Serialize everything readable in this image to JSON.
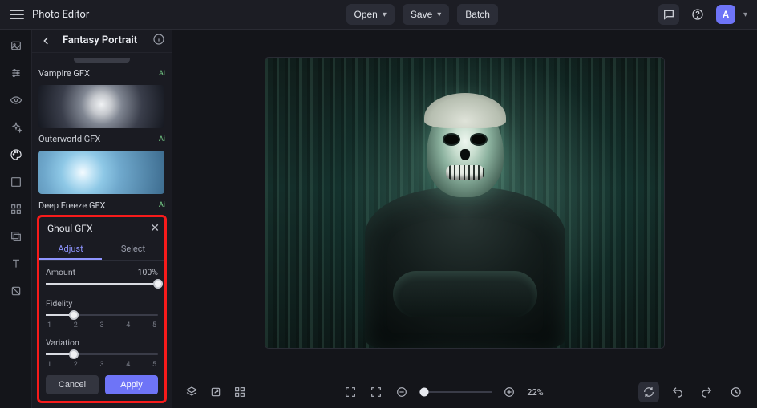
{
  "app": {
    "title": "Photo Editor",
    "avatar_initial": "A"
  },
  "topbar": {
    "open": "Open",
    "save": "Save",
    "batch": "Batch"
  },
  "panel": {
    "title": "Fantasy Portrait",
    "presets": [
      {
        "label": "Vampire GFX",
        "tag": "Ai"
      },
      {
        "label": "Outerworld GFX",
        "tag": "Ai"
      },
      {
        "label": "Deep Freeze GFX",
        "tag": "Ai"
      }
    ]
  },
  "active_effect": {
    "title": "Ghoul GFX",
    "tabs": {
      "adjust": "Adjust",
      "select": "Select"
    },
    "amount": {
      "label": "Amount",
      "value_label": "100%",
      "percent": 100
    },
    "fidelity": {
      "label": "Fidelity",
      "ticks": [
        "1",
        "2",
        "3",
        "4",
        "5"
      ],
      "value_index": 1
    },
    "variation": {
      "label": "Variation",
      "ticks": [
        "1",
        "2",
        "3",
        "4",
        "5"
      ],
      "value_index": 1
    },
    "cancel": "Cancel",
    "apply": "Apply"
  },
  "zoom": {
    "label": "22%"
  }
}
